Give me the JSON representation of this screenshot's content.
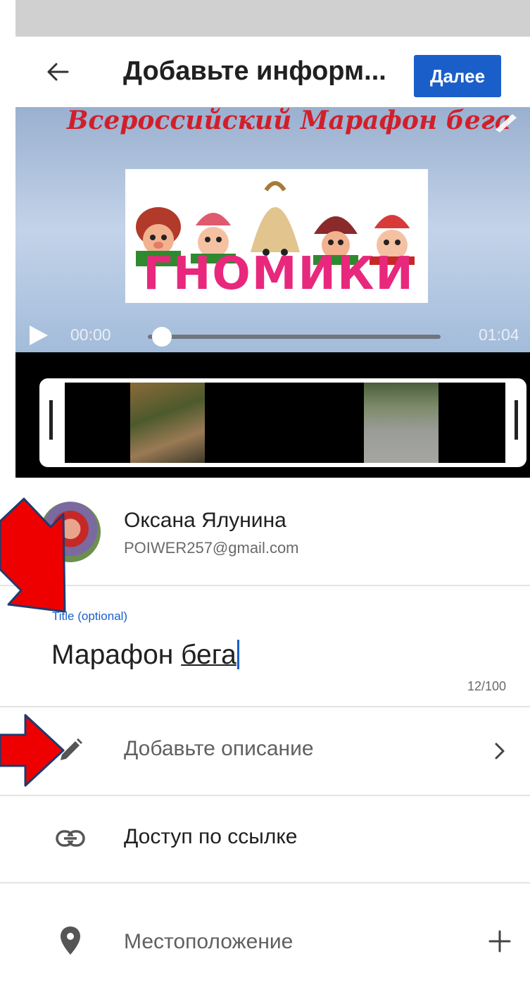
{
  "header": {
    "title": "Добавьте информ...",
    "next_label": "Далее"
  },
  "video": {
    "caption": "Всероссийский Марафон бега",
    "art_text": "ГНОМИКИ",
    "current_time": "00:00",
    "duration": "01:04",
    "progress": 0
  },
  "account": {
    "name": "Оксана Ялунина",
    "email": "POIWER257@gmail.com"
  },
  "title_field": {
    "label": "Title (optional)",
    "value_part1": "Марафон ",
    "value_part2": "бега",
    "counter": "12/100"
  },
  "rows": {
    "description_label": "Добавьте описание",
    "access_label": "Доступ по ссылке",
    "location_label": "Местоположение"
  },
  "icons": {
    "back": "back-arrow-icon",
    "play": "play-icon",
    "pencil": "pencil-icon",
    "link": "link-icon",
    "location": "location-pin-icon",
    "chevron": "chevron-right-icon",
    "plus": "plus-icon"
  },
  "colors": {
    "accent": "#1a5fc9",
    "annotation_arrow": "#ee0000"
  }
}
